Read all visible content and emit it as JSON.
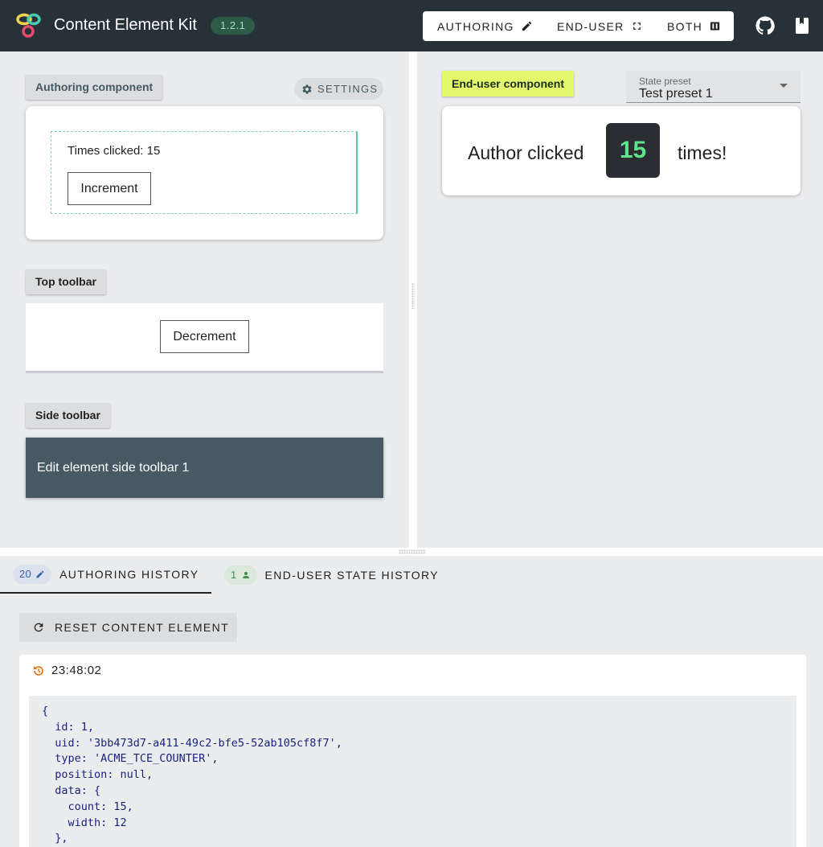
{
  "app": {
    "title": "Content Element Kit",
    "version": "1.2.1"
  },
  "modes": [
    {
      "label": "AUTHORING",
      "icon": "pencil-icon"
    },
    {
      "label": "END-USER",
      "icon": "fullscreen-icon"
    },
    {
      "label": "BOTH",
      "icon": "columns-icon"
    }
  ],
  "header_icons": [
    "github-icon",
    "book-icon"
  ],
  "authoring": {
    "chip": "Authoring component",
    "settings_label": "SETTINGS",
    "times_clicked": "Times clicked: 15",
    "increment_label": "Increment"
  },
  "top_toolbar": {
    "chip": "Top toolbar",
    "decrement_label": "Decrement"
  },
  "side_toolbar": {
    "chip": "Side toolbar",
    "text": "Edit element side toolbar 1"
  },
  "enduser": {
    "chip": "End-user component",
    "preset_label": "State preset",
    "preset_value": "Test preset 1",
    "author_clicked": "Author clicked",
    "count": "15",
    "times": "times!"
  },
  "history": {
    "tabs": [
      {
        "count": "20",
        "label": "AUTHORING HISTORY",
        "icon": "pencil-icon"
      },
      {
        "count": "1",
        "label": "END-USER STATE HISTORY",
        "icon": "person-icon"
      }
    ],
    "reset_label": "RESET CONTENT ELEMENT",
    "timestamp": "23:48:02",
    "code": "{\n  id: 1,\n  uid: '3bb473d7-a411-49c2-bfe5-52ab105cf8f7',\n  type: 'ACME_TCE_COUNTER',\n  position: null,\n  data: {\n    count: 15,\n    width: 12\n  },"
  },
  "colors": {
    "appbar": "#263238",
    "version_bg": "#2e5a48",
    "version_text": "#9ee5b9",
    "enduser_chip": "#e4f86b",
    "counter_text": "#5ee28a",
    "side_toolbar": "#475a63",
    "history_clock": "#ef6c00"
  }
}
